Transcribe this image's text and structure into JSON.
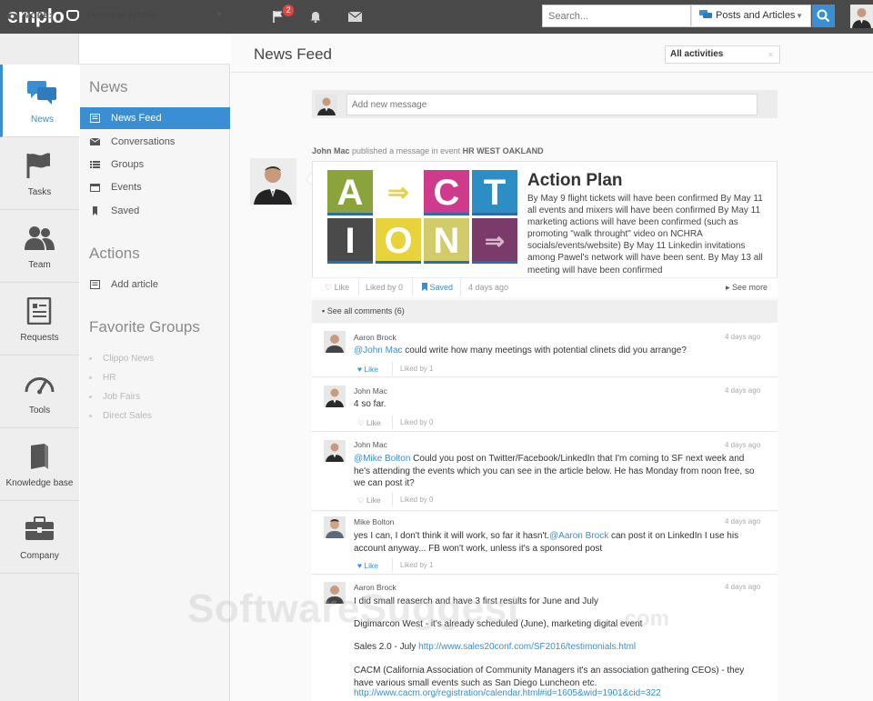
{
  "app": {
    "logo": "emplo"
  },
  "topbar": {
    "notifications_badge": "2",
    "search_placeholder": "Search...",
    "search_scope": "Posts and Articles"
  },
  "mode": {
    "label": "MODE:",
    "value": "Personal profile"
  },
  "leftnav": [
    {
      "label": "News",
      "icon": "chat-bubbles-icon",
      "active": true
    },
    {
      "label": "Tasks",
      "icon": "flag-icon"
    },
    {
      "label": "Team",
      "icon": "people-icon"
    },
    {
      "label": "Requests",
      "icon": "document-icon"
    },
    {
      "label": "Tools",
      "icon": "gauge-icon"
    },
    {
      "label": "Knowledge base",
      "icon": "book-icon"
    },
    {
      "label": "Company",
      "icon": "briefcase-icon"
    }
  ],
  "subnav": {
    "news_heading": "News",
    "news_items": [
      {
        "label": "News Feed",
        "icon": "feed-icon",
        "active": true
      },
      {
        "label": "Conversations",
        "icon": "envelope-icon"
      },
      {
        "label": "Groups",
        "icon": "list-icon"
      },
      {
        "label": "Events",
        "icon": "calendar-icon"
      },
      {
        "label": "Saved",
        "icon": "bookmark-icon"
      }
    ],
    "actions_heading": "Actions",
    "actions_items": [
      {
        "label": "Add article",
        "icon": "article-icon"
      }
    ],
    "favorites_heading": "Favorite Groups",
    "favorites": [
      "Clippo News",
      "HR",
      "Job Fairs",
      "Direct Sales"
    ]
  },
  "main": {
    "title": "News Feed",
    "filter": "All activities",
    "composer_placeholder": "Add new message"
  },
  "post": {
    "author": "John Mac",
    "action": "published a message in event",
    "event": "HR WEST OAKLAND",
    "tiles": [
      "A",
      "C",
      "T",
      "I",
      "O",
      "N"
    ],
    "title": "Action Plan",
    "body": "By May 9 flight tickets will have been confirmed By May 11 all events and mixers will have been confirmed By May 11 marketing actions will have been confirmed (such as promoting \"walk throught\" video on NCHRA socials/events/website) By May 11 Linkedin invitations among Pawel's network will have been sent.  By May 13 all meeting will have been confirmed",
    "like": "Like",
    "liked_by": "Liked by 0",
    "saved": "Saved",
    "time": "4 days ago",
    "see_more": "See more",
    "see_all_comments": "See all comments (6)"
  },
  "comments": [
    {
      "name": "Aaron Brock",
      "time": "4 days ago",
      "mention": "@John Mac",
      "text": " could write how many meetings with potential clinets did you arrange?",
      "like": "Like",
      "liked_by": "Liked by 1"
    },
    {
      "name": "John Mac",
      "time": "4 days ago",
      "mention": "",
      "text": "4 so far.",
      "like": "Like",
      "liked_by": "Liked by 0"
    },
    {
      "name": "John Mac",
      "time": "4 days ago",
      "mention": "@Mike Bolton",
      "text": " Could you post on Twitter/Facebook/LinkedIn that I'm coming to SF next week and he's attending the events which you can see in the article below. He has Monday from noon free, so we can post it?",
      "like": "Like",
      "liked_by": "Liked by 0"
    },
    {
      "name": "Mike Bolton",
      "time": "4 days ago",
      "text_a": "yes I can, I don't think it will work, so far it hasn't.",
      "mention": "@Aaron Brock",
      "text_b": " can post it on LinkedIn I use his account anyway... FB won't work, unless it's a sponsored post",
      "like": "Like",
      "liked_by": "Liked by 1"
    },
    {
      "name": "Aaron Brock",
      "time": "4 days ago",
      "line1": "I did small reaserch and have 3 first results for June and July",
      "line2": "Digimarcon West - it's already scheduled (June), marketing digital event",
      "line3_prefix": "Sales 2.0 - July ",
      "line3_link": "http://www.sales20conf.com/SF2016/testimonials.html",
      "line4": "CACM (California Association of Community Managers it's an association gathering CEOs) - they have various small events such as San Diego Luncheon etc.",
      "line4_link": "http://www.cacm.org/registration/calendar.html#id=1605&wid=1901&cid=322"
    }
  ],
  "watermark": {
    "main": "SoftwareSuggest",
    "suffix": ".com"
  },
  "colors": {
    "accent": "#3a8ed4",
    "topbar": "#4a4a4a",
    "badge": "#e0463f"
  }
}
